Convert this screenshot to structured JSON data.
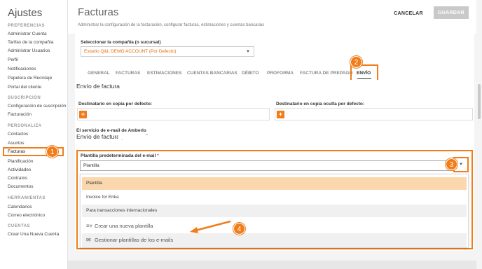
{
  "sidebar": {
    "title": "Ajustes",
    "sections": [
      {
        "label": "PREFERENCIAS",
        "items": [
          "Administrar Cuenta",
          "Tarifas de la compañía",
          "Administrar Usuarios",
          "Perfil",
          "Notificaciones",
          "Papelera de Reciclaje",
          "Portal del cliente"
        ]
      },
      {
        "label": "SUSCRIPCIÓN",
        "items": [
          "Configuración de suscripción",
          "Facturación"
        ]
      },
      {
        "label": "PERSONALIZA",
        "items": [
          "Contactos",
          "Asuntos",
          "Facturas",
          "Planificación",
          "Actividades",
          "Contratos",
          "Documentos"
        ]
      },
      {
        "label": "HERRAMIENTAS",
        "items": [
          "Calendarios",
          "Correo electrónico"
        ]
      },
      {
        "label": "CUENTAS",
        "items": [
          "Crear Una Nueva Cuenta"
        ]
      }
    ]
  },
  "header": {
    "title": "Facturas",
    "description": "Administrar la configuración de la facturación, configurar facturas, estimaciones y cuentas bancarias",
    "cancel_label": "CANCELAR",
    "save_label": "GUARDAR"
  },
  "company": {
    "label": "Seleccionar la compañía (o sucursal)",
    "value": "Estudio Q&L DEMO ACCOUNT (Por Defecto)"
  },
  "tabs": [
    "GENERAL",
    "FACTURAS",
    "ESTIMACIONES",
    "CUENTAS BANCARIAS",
    "DÉBITO",
    "PROFORMA",
    "FACTURA DE PREPAGO",
    "ENVÍO"
  ],
  "envio": {
    "section_title": "Envío de factura",
    "cc_label": "Destinatario en copia por defecto:",
    "bcc_label": "Destinatario en copia oculta por defecto:",
    "service_title": "El servicio de e-mail de Amberlo",
    "service_subtitle": "Envío de factura por e-mail",
    "template_label": "Plantilla predeterminada del e-mail",
    "template_required": "*",
    "template_value": "Plantilla",
    "options": [
      "Plantilla",
      "Invoice for Erika",
      "Para transacciones internacionales"
    ],
    "create_label": "Crear una nueva plantilla",
    "manage_label": "Gestionar plantillas de los e-mails"
  },
  "annotations": [
    "1",
    "2",
    "3",
    "4"
  ],
  "colors": {
    "accent": "#f07d1a",
    "selected_option": "#fbd7ae",
    "company_value": "#e36c0a"
  }
}
